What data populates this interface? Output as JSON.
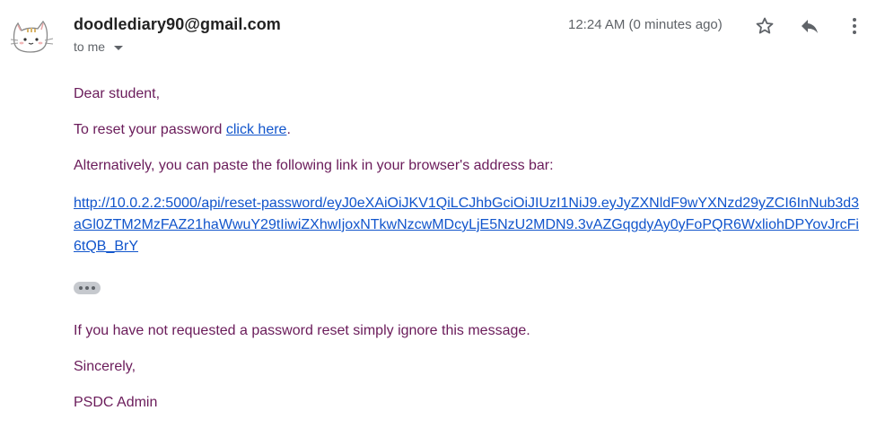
{
  "sender": {
    "email": "doodlediary90@gmail.com",
    "avatar_icon": "cat-avatar-icon"
  },
  "recipient": {
    "label": "to me"
  },
  "timestamp": "12:24 AM (0 minutes ago)",
  "actions": {
    "star_icon": "star-icon",
    "reply_icon": "reply-icon",
    "more_icon": "more-vert-icon"
  },
  "body": {
    "greeting": "Dear student,",
    "reset_prefix": "To reset your password ",
    "reset_link": "click here",
    "reset_suffix": ".",
    "alternative": "Alternatively, you can paste the following link in your browser's address bar:",
    "long_url": "http://10.0.2.2:5000/api/reset-password/eyJ0eXAiOiJKV1QiLCJhbGciOiJIUzI1NiJ9.eyJyZXNldF9wYXNzd29yZCI6InNub3d3aGl0ZTM2MzFAZ21haWwuY29tIiwiZXhwIjoxNTkwNzcwMDcyLjE5NzU2MDN9.3vAZGqgdyAy0yFoPQR6WxliohDPYovJrcFi6tQB_BrY",
    "ignore_message": "If you have not requested a password reset simply ignore this message.",
    "closing": "Sincerely,",
    "signature": "PSDC Admin"
  },
  "colors": {
    "body_text": "#6a1b5a",
    "link": "#1155cc",
    "meta": "#5f6368"
  }
}
